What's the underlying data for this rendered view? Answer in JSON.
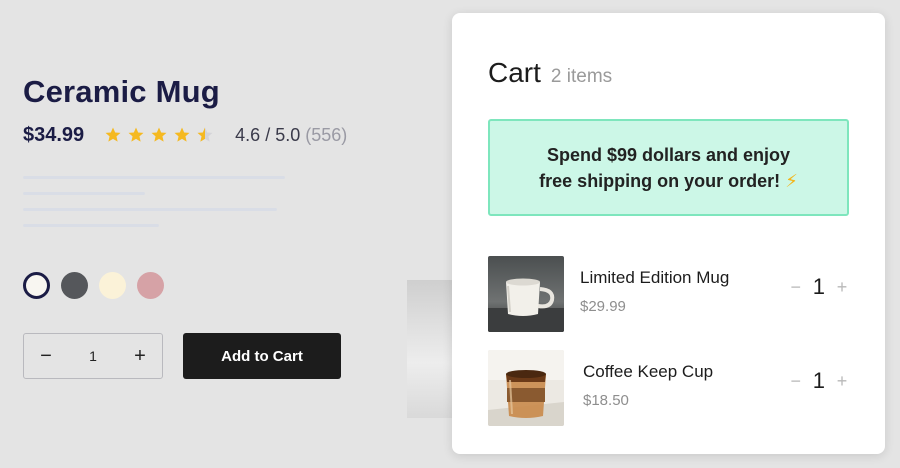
{
  "product": {
    "title": "Ceramic Mug",
    "price": "$34.99",
    "rating_fraction": 0.92,
    "rating_text": "4.6 / 5.0",
    "review_count": "(556)",
    "swatches": [
      {
        "name": "white",
        "color": "#f8f6f1",
        "selected": true
      },
      {
        "name": "charcoal",
        "color": "#55575b",
        "selected": false
      },
      {
        "name": "cream",
        "color": "#fbf2d8",
        "selected": false
      },
      {
        "name": "rose",
        "color": "#d6a2a6",
        "selected": false
      }
    ],
    "quantity": {
      "minus": "−",
      "value": "1",
      "plus": "+"
    },
    "add_to_cart_label": "Add to Cart"
  },
  "cart": {
    "title": "Cart",
    "count_label": "2 items",
    "promo_line1": "Spend $99 dollars and enjoy",
    "promo_line2": "free shipping on your order!",
    "promo_icon": "⚡",
    "items": [
      {
        "name": "Limited Edition Mug",
        "price": "$29.99",
        "quantity": "1",
        "minus": "−",
        "plus": "+",
        "image": "white-mug-photo"
      },
      {
        "name": "Coffee Keep Cup",
        "price": "$18.50",
        "quantity": "1",
        "minus": "−",
        "plus": "+",
        "image": "keep-cup-photo"
      }
    ]
  },
  "colors": {
    "accent_dark": "#1b1c45",
    "star": "#f5b921",
    "promo_bg": "#ccf7e7",
    "promo_border": "#7ee6bd",
    "button_bg": "#1c1c1c"
  }
}
